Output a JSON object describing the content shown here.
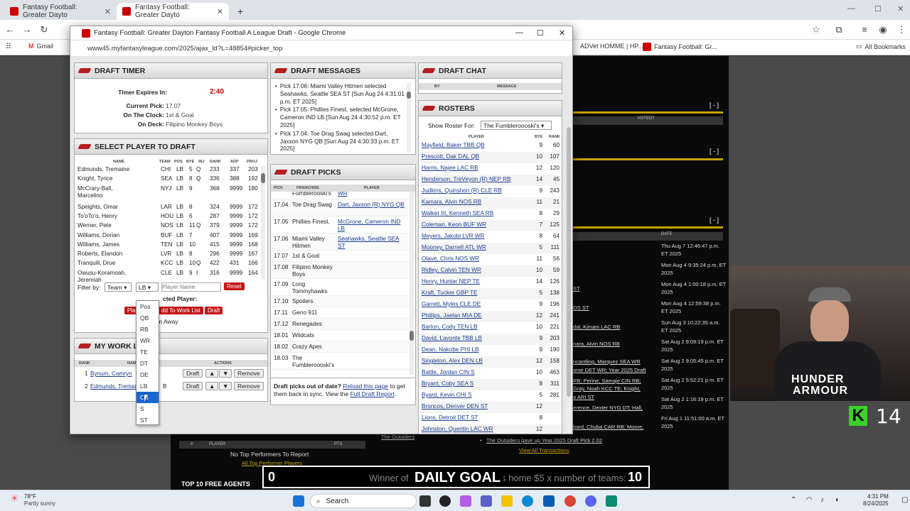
{
  "browser": {
    "tabs": [
      {
        "title": "Fantasy Football: Greater Dayto"
      },
      {
        "title": "Fantasy Football: Greater Dayto"
      }
    ],
    "new_tab": "+",
    "bookmarks": [
      {
        "label": "Gmail"
      },
      {
        "label": "ADVet HOMME | HP..."
      },
      {
        "label": "Fantasy Football: Gr..."
      },
      {
        "label": "All Bookmarks"
      }
    ]
  },
  "popup": {
    "title": "Fantasy Football: Greater Dayton Fantasy Football A League Draft - Google Chrome",
    "url": "www45.myfantasyleague.com/2025/ajax_ld?L=48854#picker_top"
  },
  "draft_timer": {
    "title": "DRAFT TIMER",
    "expires_label": "Timer Expires In:",
    "expires_value": "2:40",
    "current_label": "Current Pick:",
    "current_value": "17.07",
    "clock_label": "On The Clock:",
    "clock_value": "1st & Goal",
    "deck_label": "On Deck:",
    "deck_value": "Filipino Monkey Boys"
  },
  "select_player": {
    "title": "SELECT PLAYER TO DRAFT",
    "columns": [
      "NAME",
      "TEAM",
      "POS",
      "BYE",
      "INJ",
      "RANK",
      "ADP",
      "PROJ"
    ],
    "rows": [
      {
        "name": "Edmunds, Tremaine",
        "team": "CHI",
        "pos": "LB",
        "bye": "5",
        "inj": "Q",
        "rank": "233",
        "adp": "337",
        "proj": "203"
      },
      {
        "name": "Knight, Tyrice",
        "team": "SEA",
        "pos": "LB",
        "bye": "8",
        "inj": "Q",
        "rank": "336",
        "adp": "388",
        "proj": "192"
      },
      {
        "name": "McCrary-Ball, Marcelino",
        "team": "NYJ",
        "pos": "LB",
        "bye": "9",
        "inj": "",
        "rank": "368",
        "adp": "9999",
        "proj": "180"
      },
      {
        "name": "Speights, Omar",
        "team": "LAR",
        "pos": "LB",
        "bye": "8",
        "inj": "",
        "rank": "324",
        "adp": "9999",
        "proj": "172"
      },
      {
        "name": "To'oTo'o, Henry",
        "team": "HOU",
        "pos": "LB",
        "bye": "6",
        "inj": "",
        "rank": "287",
        "adp": "9999",
        "proj": "172"
      },
      {
        "name": "Werner, Pete",
        "team": "NOS",
        "pos": "LB",
        "bye": "11",
        "inj": "Q",
        "rank": "379",
        "adp": "9999",
        "proj": "172"
      },
      {
        "name": "Williams, Dorian",
        "team": "BUF",
        "pos": "LB",
        "bye": "7",
        "inj": "",
        "rank": "407",
        "adp": "9999",
        "proj": "169"
      },
      {
        "name": "Williams, James",
        "team": "TEN",
        "pos": "LB",
        "bye": "10",
        "inj": "",
        "rank": "415",
        "adp": "9999",
        "proj": "168"
      },
      {
        "name": "Roberts, Elandon",
        "team": "LVR",
        "pos": "LB",
        "bye": "8",
        "inj": "",
        "rank": "296",
        "adp": "9999",
        "proj": "167"
      },
      {
        "name": "Tranquill, Drue",
        "team": "KCC",
        "pos": "LB",
        "bye": "10",
        "inj": "Q",
        "rank": "422",
        "adp": "431",
        "proj": "166"
      },
      {
        "name": "Owusu-Koramoah, Jeremiah",
        "team": "CLE",
        "pos": "LB",
        "bye": "9",
        "inj": "I",
        "rank": "316",
        "adp": "9999",
        "proj": "164"
      }
    ],
    "filter_label": "Filter by:",
    "team_select": "Team",
    "pos_select": "LB",
    "name_placeholder": "Player Name",
    "reset": "Reset",
    "selected_label": "cted Player:",
    "play_btn": "Play",
    "add_work_btn": "dd To Work List",
    "draft_btn": "Draft",
    "away_label": "I'm Away"
  },
  "pos_dropdown": {
    "options": [
      "Pos",
      "QB",
      "RB",
      "WR",
      "TE",
      "DT",
      "DE",
      "LB",
      "CB",
      "S",
      "ST"
    ],
    "highlighted": "CB"
  },
  "work_list": {
    "title": "MY WORK LI",
    "col_rank": "RANK",
    "col_name": "NAM",
    "col_actions": "ACTIONS",
    "rows": [
      {
        "rank": "1",
        "name": "Bynum, Camryn"
      },
      {
        "rank": "2",
        "name": "Edmunds, Tremaine",
        "tail": "B"
      }
    ],
    "draft": "Draft",
    "up": "▲",
    "down": "▼",
    "remove": "Remove"
  },
  "draft_messages": {
    "title": "DRAFT MESSAGES",
    "items": [
      "Pick 17.06: Miami Valley Hitmen selected Seahawks, Seattle SEA ST [Sun Aug 24 4:31:01 p.m. ET 2025]",
      "Pick 17.05: Phillies Finest. selected McGrone, Cameron IND LB [Sun Aug 24 4:30:52 p.m. ET 2025]",
      "Pick 17.04: Toe Drag Swag selected Dart, Jaxson NYG QB [Sun Aug 24 4:30:33 p.m. ET 2025]"
    ]
  },
  "draft_picks": {
    "title": "DRAFT PICKS",
    "col_pick": "PICK",
    "col_franchise": "FRANCHISE",
    "col_player": "PLAYER",
    "rows": [
      {
        "pick": "",
        "franchise": "Fumblerooski's",
        "player": "WR"
      },
      {
        "pick": "17.04",
        "franchise": "Toe Drag Swag",
        "player": "Dart, Jaxson (R) NYG QB"
      },
      {
        "pick": "17.05",
        "franchise": "Phillies Finest.",
        "player": "McGrone, Cameron IND LB"
      },
      {
        "pick": "17.06",
        "franchise": "Miami Valley Hitmen",
        "player": "Seahawks, Seattle SEA ST"
      },
      {
        "pick": "17.07",
        "franchise": "1st & Goal",
        "player": ""
      },
      {
        "pick": "17.08",
        "franchise": "Filipino Monkey Boys",
        "player": ""
      },
      {
        "pick": "17.09",
        "franchise": "Long Tommyhawks",
        "player": ""
      },
      {
        "pick": "17.10",
        "franchise": "Spoilers",
        "player": ""
      },
      {
        "pick": "17.11",
        "franchise": "Geno 911",
        "player": ""
      },
      {
        "pick": "17.12",
        "franchise": "Renegades",
        "player": ""
      },
      {
        "pick": "18.01",
        "franchise": "Wildcats",
        "player": ""
      },
      {
        "pick": "18.02",
        "franchise": "Crazy Apes",
        "player": ""
      },
      {
        "pick": "18.03",
        "franchise": "The Fumbleroooski's",
        "player": ""
      }
    ],
    "outdated_text": "Draft picks out of date?",
    "reload_link": "Reload this page",
    "outdated_tail": "to get them back in sync. View the",
    "full_report": "Full Draft Report"
  },
  "draft_chat": {
    "title": "DRAFT CHAT",
    "col_by": "BY",
    "col_msg": "MESSAGE"
  },
  "rosters": {
    "title": "ROSTERS",
    "show_label": "Show Roster For:",
    "selected": "The Fumbleroooski's",
    "col_player": "PLAYER",
    "col_bye": "BYE",
    "col_rank": "RANK",
    "rows": [
      {
        "player": "Mayfield, Baker TBB QB",
        "bye": "9",
        "rank": "60"
      },
      {
        "player": "Prescott, Dak DAL QB",
        "bye": "10",
        "rank": "107"
      },
      {
        "player": "Harris, Najee LAC RB",
        "bye": "12",
        "rank": "120"
      },
      {
        "player": "Henderson, TreVeyon (R) NEP RB",
        "bye": "14",
        "rank": "45"
      },
      {
        "player": "Judkins, Quinshon (R) CLE RB",
        "bye": "9",
        "rank": "243"
      },
      {
        "player": "Kamara, Alvin NOS RB",
        "bye": "11",
        "rank": "21"
      },
      {
        "player": "Walker III, Kenneth SEA RB",
        "bye": "8",
        "rank": "29"
      },
      {
        "player": "Coleman, Keon BUF WR",
        "bye": "7",
        "rank": "125"
      },
      {
        "player": "Meyers, Jakobi LVR WR",
        "bye": "8",
        "rank": "64"
      },
      {
        "player": "Mooney, Darnell ATL WR",
        "bye": "5",
        "rank": "111"
      },
      {
        "player": "Olave, Chris NOS WR",
        "bye": "11",
        "rank": "56"
      },
      {
        "player": "Ridley, Calvin TEN WR",
        "bye": "10",
        "rank": "59"
      },
      {
        "player": "Henry, Hunter NEP TE",
        "bye": "14",
        "rank": "126"
      },
      {
        "player": "Kraft, Tucker GBP TE",
        "bye": "5",
        "rank": "138"
      },
      {
        "player": "Garrett, Myles CLE DE",
        "bye": "9",
        "rank": "196"
      },
      {
        "player": "Phillips, Jaelan MIA DE",
        "bye": "12",
        "rank": "241"
      },
      {
        "player": "Barton, Cody TEN LB",
        "bye": "10",
        "rank": "221"
      },
      {
        "player": "Lavonte TBB LB",
        "prefix": "David, ",
        "bye": "9",
        "rank": "203"
      },
      {
        "player": "Dean, Nakobe PHI LB",
        "bye": "9",
        "rank": "190"
      },
      {
        "player": "Singleton, Alex DEN LB",
        "bye": "12",
        "rank": "158"
      },
      {
        "player": "Battle, Jordan CIN S",
        "bye": "10",
        "rank": "463"
      },
      {
        "player": "Bryant, Coby SEA S",
        "bye": "8",
        "rank": "311"
      },
      {
        "player": "Byard, Kevin CHI S",
        "bye": "5",
        "rank": "281"
      },
      {
        "player": "Broncos, Denver DEN ST",
        "bye": "12",
        "rank": ""
      },
      {
        "player": "Lions, Detroit DET ST",
        "bye": "8",
        "rank": ""
      },
      {
        "player": "Johnston, Quentin LAC WR",
        "bye": "12",
        "rank": ""
      }
    ]
  },
  "bg_page": {
    "minus": "[ - ]",
    "voted": "VOTED?",
    "date_header": "DATE",
    "dates": [
      "Thu Aug 7 12:46:47 p.m. ET 2025",
      "Mon Aug 4 9:35:24 p.m. ET 2025",
      "Mon Aug 4 1:00:18 p.m. ET 2025",
      "Mon Aug 4 12:59:38 p.m. ET 2025",
      "Sun Aug 3 10:22:35 a.m. ET 2025",
      "Sat Aug 2 9:09:19 p.m. ET 2025",
      "Sat Aug 2 9:05:45 p.m. ET 2025",
      "Sat Aug 2 5:52:21 p.m. ET 2025",
      "Sat Aug 2 1:16:19 p.m. ET 2025",
      "Fri Aug 1 11:51:00 a.m. ET 2025"
    ],
    "left_links": [
      "ST",
      "OS ST",
      "dal, Kimani LAC RB",
      "nara, Alvin NOS RB",
      "ncantling, Marquez SEA WR",
      "ame DET WR; Year 2025 Draft",
      "RB; Perine, Samaje CIN RB;",
      "Gray, Noah KCC TE; Knight,",
      "a ARI ST",
      "erence, Dexter NYG DT; Hall,",
      "bard, Chuba CAR RB; Moore,"
    ],
    "outsiders1": "The Outsiders",
    "outsiders2": "The Outsiders gave up Year 2025 Draft Pick 2.02",
    "view_all": "View All Transactions",
    "performers_cols": [
      "#",
      "PLAYER",
      "PTS"
    ],
    "no_top": "No Top Performers To Report",
    "all_top": "All Top Performer Players",
    "free_agents": "TOP 10 FREE AGENTS",
    "fa_minus": "[ - ]"
  },
  "goal": {
    "left": "0",
    "label": "DAILY GOAL",
    "right": "10",
    "ticker": "Winner of C",
    "ticker2": "s home $5 x number of teams:"
  },
  "webcam": {
    "shirt_line1": "HUNDER",
    "shirt_line2": "ARMOUR",
    "kick_count": "14",
    "kick_letter": "K"
  },
  "taskbar": {
    "weather_temp": "78°F",
    "weather_desc": "Partly sunny",
    "search": "Search",
    "time": "4:31 PM",
    "date": "8/24/2025"
  },
  "colors": {
    "accent_red": "#b41e1e",
    "link_blue": "#1a3d8f",
    "highlight": "#1967d2",
    "gold": "#c8a200",
    "kick_green": "#39d12a"
  }
}
